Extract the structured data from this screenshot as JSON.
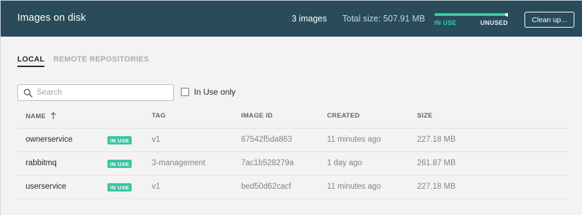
{
  "header": {
    "title": "Images on disk",
    "image_count": "3 images",
    "total_size": "Total size: 507.91 MB",
    "usage": {
      "in_use_label": "IN USE",
      "unused_label": "UNUSED",
      "in_use_fraction": 0.96,
      "in_use_color": "#2ed0a2",
      "unused_color": "#ffffff"
    },
    "cleanup_label": "Clean up..."
  },
  "tabs": [
    {
      "label": "LOCAL",
      "active": true
    },
    {
      "label": "REMOTE REPOSITORIES",
      "active": false
    }
  ],
  "search": {
    "placeholder": "Search",
    "value": ""
  },
  "filter": {
    "label": "In Use only",
    "checked": false
  },
  "table": {
    "columns": {
      "name": "NAME",
      "tag": "TAG",
      "image_id": "IMAGE ID",
      "created": "CREATED",
      "size": "SIZE"
    },
    "sort": {
      "column": "name",
      "direction": "ascending"
    },
    "rows": [
      {
        "name": "ownerservice",
        "badge": "IN USE",
        "tag": "v1",
        "image_id": "67542f5da863",
        "created": "11 minutes ago",
        "size": "227.18 MB"
      },
      {
        "name": "rabbitmq",
        "badge": "IN USE",
        "tag": "3-management",
        "image_id": "7ac1b528279a",
        "created": "1 day ago",
        "size": "261.87 MB"
      },
      {
        "name": "userservice",
        "badge": "IN USE",
        "tag": "v1",
        "image_id": "bed50d62cacf",
        "created": "11 minutes ago",
        "size": "227.18 MB"
      }
    ]
  },
  "colors": {
    "header_bg": "#294b5a",
    "accent": "#2ed0a2",
    "badge": "#3bc5a4"
  },
  "icons": {
    "search": "search-icon",
    "sort": "arrow-up-icon",
    "checkbox": "checkbox-icon"
  }
}
